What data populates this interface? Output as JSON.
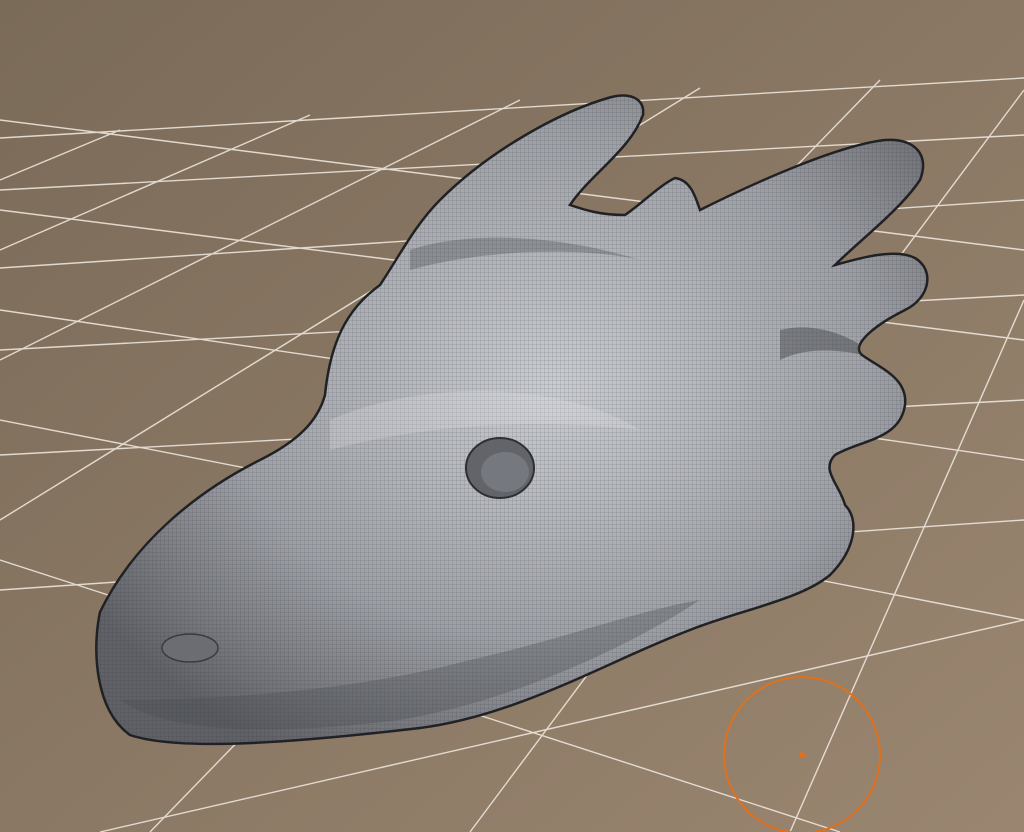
{
  "viewport": {
    "background_top": "#7a6a58",
    "background_bottom": "#9a8670",
    "grid_color": "#f3ece3",
    "mesh_base_color": "#9da0a6",
    "mesh_highlight_color": "#c9ccd1",
    "mesh_shadow_color": "#5f6167",
    "wire_color": "#2b2c30",
    "brush_cursor_color": "#e0701c"
  },
  "mesh": {
    "name": "dragon-head-sculpt",
    "display": "wireframe-on-shaded",
    "eye_socket": true
  },
  "tool": {
    "brush_cursor": "circle"
  }
}
